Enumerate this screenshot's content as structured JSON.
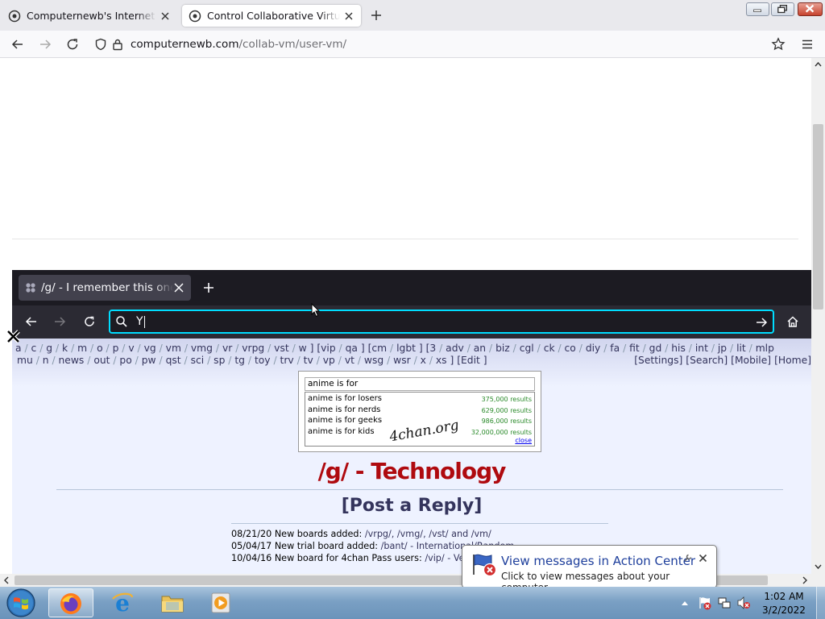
{
  "browser": {
    "tabs": [
      {
        "title": "Computernewb's Internet Pub H",
        "active": false
      },
      {
        "title": "Control Collaborative Virtual M",
        "active": true
      }
    ],
    "url_host": "computernewb.com",
    "url_path": "/collab-vm/user-vm/"
  },
  "vm": {
    "tab_title": "/g/ - I remember this one",
    "url_input": "Y",
    "board_nav": {
      "line1": [
        "a",
        "c",
        "g",
        "k",
        "m",
        "o",
        "p",
        "v",
        "vg",
        "vm",
        "vmg",
        "vr",
        "vrpg",
        "vst",
        "w",
        "vip",
        "qa",
        "cm",
        "lgbt",
        "3",
        "adv",
        "an",
        "biz",
        "cgl",
        "ck",
        "co",
        "diy",
        "fa",
        "fit",
        "gd",
        "his",
        "int",
        "jp",
        "lit",
        "mlp"
      ],
      "line2": [
        "mu",
        "n",
        "news",
        "out",
        "po",
        "pw",
        "qst",
        "sci",
        "sp",
        "tg",
        "toy",
        "trv",
        "tv",
        "vp",
        "vt",
        "wsg",
        "wsr",
        "x",
        "xs",
        "Edit"
      ],
      "right": [
        "Settings",
        "Search",
        "Mobile",
        "Home"
      ]
    },
    "banner": {
      "query": "anime is for",
      "suggestions": [
        {
          "text": "anime is for losers",
          "count": "375,000 results"
        },
        {
          "text": "anime is for nerds",
          "count": "629,000 results"
        },
        {
          "text": "anime is for geeks",
          "count": "986,000 results"
        },
        {
          "text": "anime is for kids",
          "count": "32,000,000 results"
        }
      ],
      "logo": "4chan.org",
      "close": "close"
    },
    "board_title": "/g/ - Technology",
    "post_reply": "[Post a Reply]",
    "news": [
      {
        "date": "08/21/20",
        "text": "New boards added: ",
        "link": "/vrpg/, /vmg/, /vst/ and /vm/"
      },
      {
        "date": "05/04/17",
        "text": "New trial board added: ",
        "link": "/bant/ - International/Random"
      },
      {
        "date": "10/04/16",
        "text": "New board for 4chan Pass users: ",
        "link": "/vip/ - Very Important Posts"
      }
    ]
  },
  "notification": {
    "title": "View messages in Action Center",
    "text": "Click to view messages about your computer."
  },
  "taskbar": {
    "time": "1:02 AM",
    "date": "3/2/2022"
  },
  "colors": {
    "accent": "#00ddff",
    "board_title": "#af0a0f",
    "link": "#34345c"
  }
}
